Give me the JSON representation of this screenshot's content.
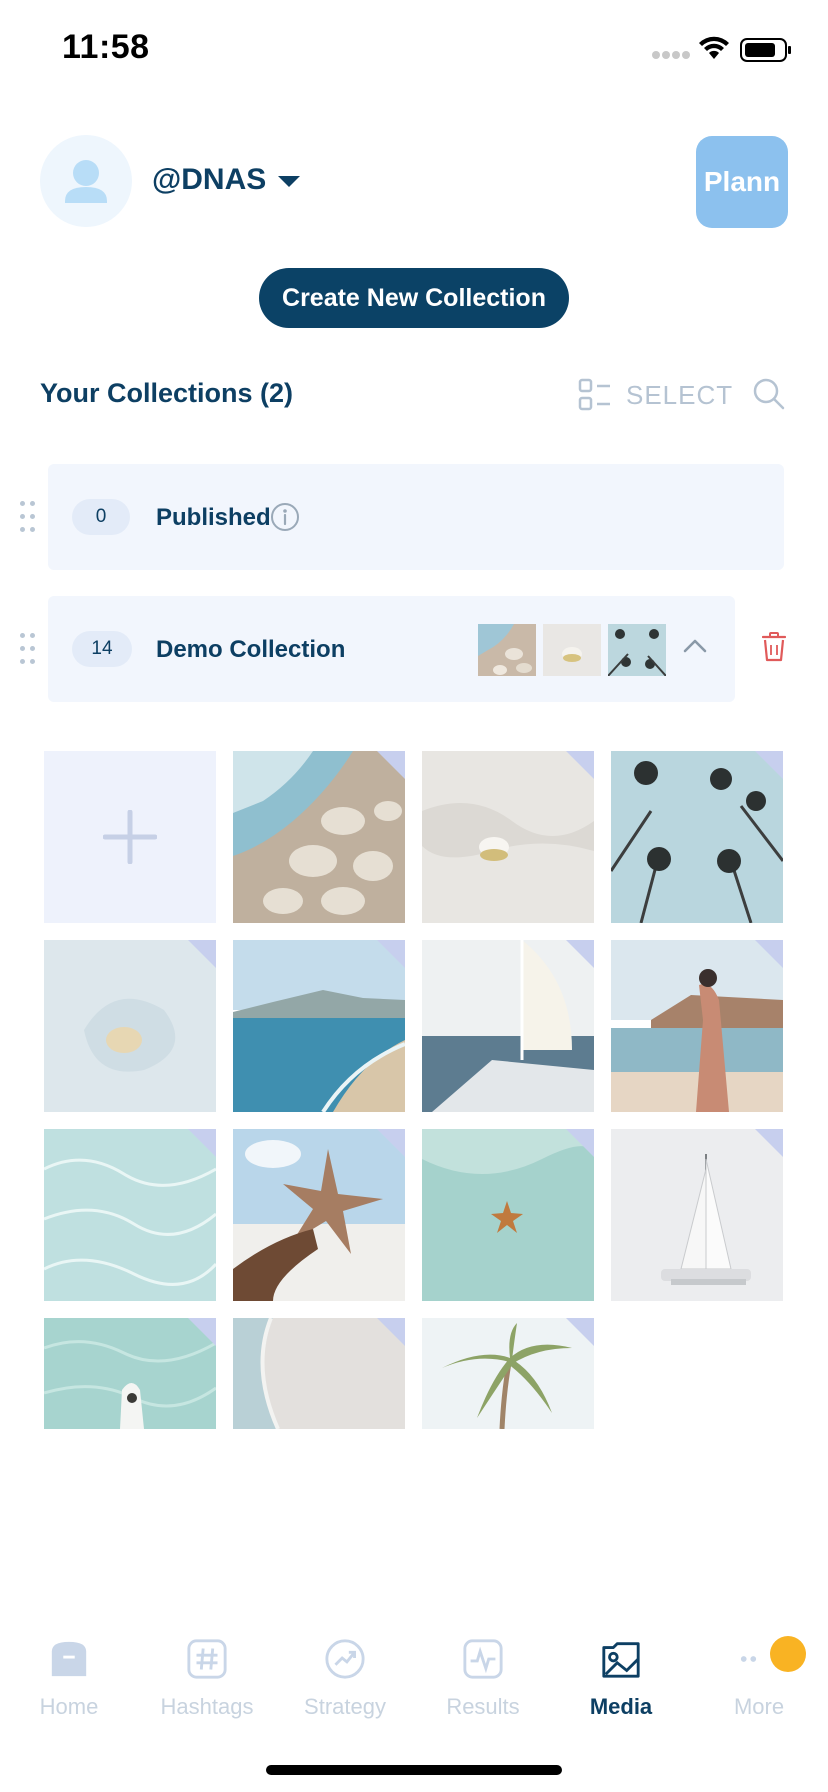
{
  "status_bar": {
    "time": "11:58"
  },
  "profile": {
    "handle": "@DNAS",
    "badge_label": "Plann"
  },
  "create_button": {
    "label": "Create New Collection"
  },
  "collections_header": {
    "title": "Your Collections (2)",
    "select_label": "SELECT"
  },
  "collections": [
    {
      "count": "0",
      "name": "Published"
    },
    {
      "count": "14",
      "name": "Demo Collection"
    }
  ],
  "tabs": [
    {
      "label": "Home",
      "icon": "home-icon"
    },
    {
      "label": "Hashtags",
      "icon": "hashtag-icon"
    },
    {
      "label": "Strategy",
      "icon": "strategy-icon"
    },
    {
      "label": "Results",
      "icon": "results-icon"
    },
    {
      "label": "Media",
      "icon": "media-icon",
      "active": true
    },
    {
      "label": "More",
      "icon": "more-icon"
    }
  ],
  "colors": {
    "brand_navy": "#0b4266",
    "plann_blue": "#8cc1ee",
    "card_bg": "#f2f6fd",
    "trash_red": "#e05a5a",
    "notification": "#f9b323"
  }
}
